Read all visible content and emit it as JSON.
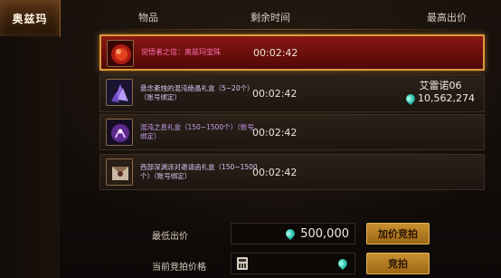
{
  "left_tab": {
    "label": "奥兹玛"
  },
  "header": {
    "col_item": "物品",
    "col_time": "剩余时间",
    "col_bid": "最高出价"
  },
  "rows": [
    {
      "name": "觉悟者之信：奥兹玛宝珠",
      "time": "00:02:42",
      "bidder": "",
      "amount": "",
      "selected": true,
      "thumb_icon": "orb-icon"
    },
    {
      "name": "悬念紊烛的混沌绝晶礼盒（5~20个）（账号绑定）",
      "time": "00:02:42",
      "bidder": "艾雷诺06",
      "amount": "10,562,274",
      "selected": false,
      "thumb_icon": "crystal-icon"
    },
    {
      "name": "混沌之息礼盒（150~1500个）（账号绑定）",
      "time": "00:02:42",
      "bidder": "",
      "amount": "",
      "selected": false,
      "thumb_icon": "chaos-breath-icon"
    },
    {
      "name": "西部深渊派对邀请函礼盒（150~1500个）（账号绑定）",
      "time": "00:02:42",
      "bidder": "",
      "amount": "",
      "selected": false,
      "thumb_icon": "invitation-icon"
    }
  ],
  "footer": {
    "min_bid_label": "最低出价",
    "min_bid_value": "500,000",
    "raise_button": "加价竞拍",
    "current_bid_label": "当前竞拍价格",
    "current_bid_value": "",
    "bid_button": "竞拍"
  },
  "colors": {
    "selected_row": "#7a120e",
    "gold_button": "#b07a22",
    "gem": "#2ec7b0"
  }
}
